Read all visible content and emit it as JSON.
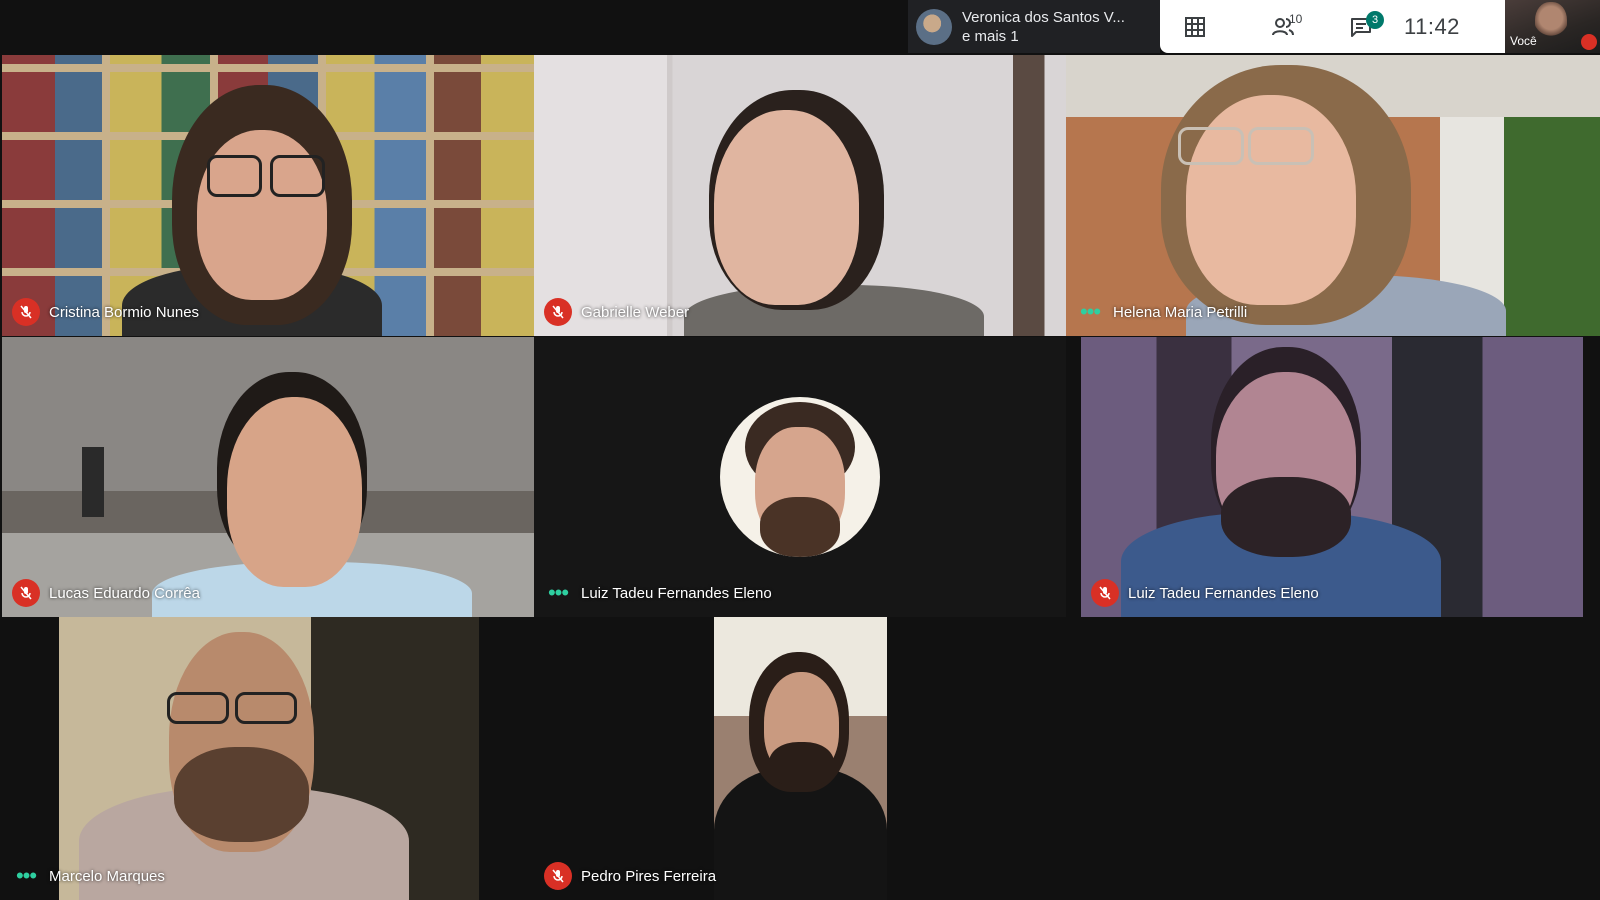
{
  "presenter": {
    "name": "Veronica dos Santos V...",
    "extra": "e mais 1"
  },
  "controls": {
    "grid_icon": "grid-icon",
    "people_icon": "people-icon",
    "people_count": "10",
    "chat_icon": "chat-icon",
    "chat_count": "3",
    "time": "11:42"
  },
  "self": {
    "label": "Você",
    "mic_icon": "mic-off-icon"
  },
  "colors": {
    "background": "#111111",
    "mic_muted": "#d93025",
    "speaking_dots": "#2ecfa0",
    "chat_badge": "#00796b"
  },
  "participants": [
    {
      "name": "Cristina Bormio Nunes",
      "status": "muted"
    },
    {
      "name": "Gabrielle Weber",
      "status": "muted"
    },
    {
      "name": "Helena Maria Petrilli",
      "status": "active"
    },
    {
      "name": "Lucas Eduardo Corrêa",
      "status": "muted"
    },
    {
      "name": "Luiz Tadeu Fernandes Eleno",
      "status": "active"
    },
    {
      "name": "Luiz Tadeu Fernandes Eleno",
      "status": "muted"
    },
    {
      "name": "Marcelo Marques",
      "status": "active"
    },
    {
      "name": "Pedro Pires Ferreira",
      "status": "muted"
    }
  ]
}
